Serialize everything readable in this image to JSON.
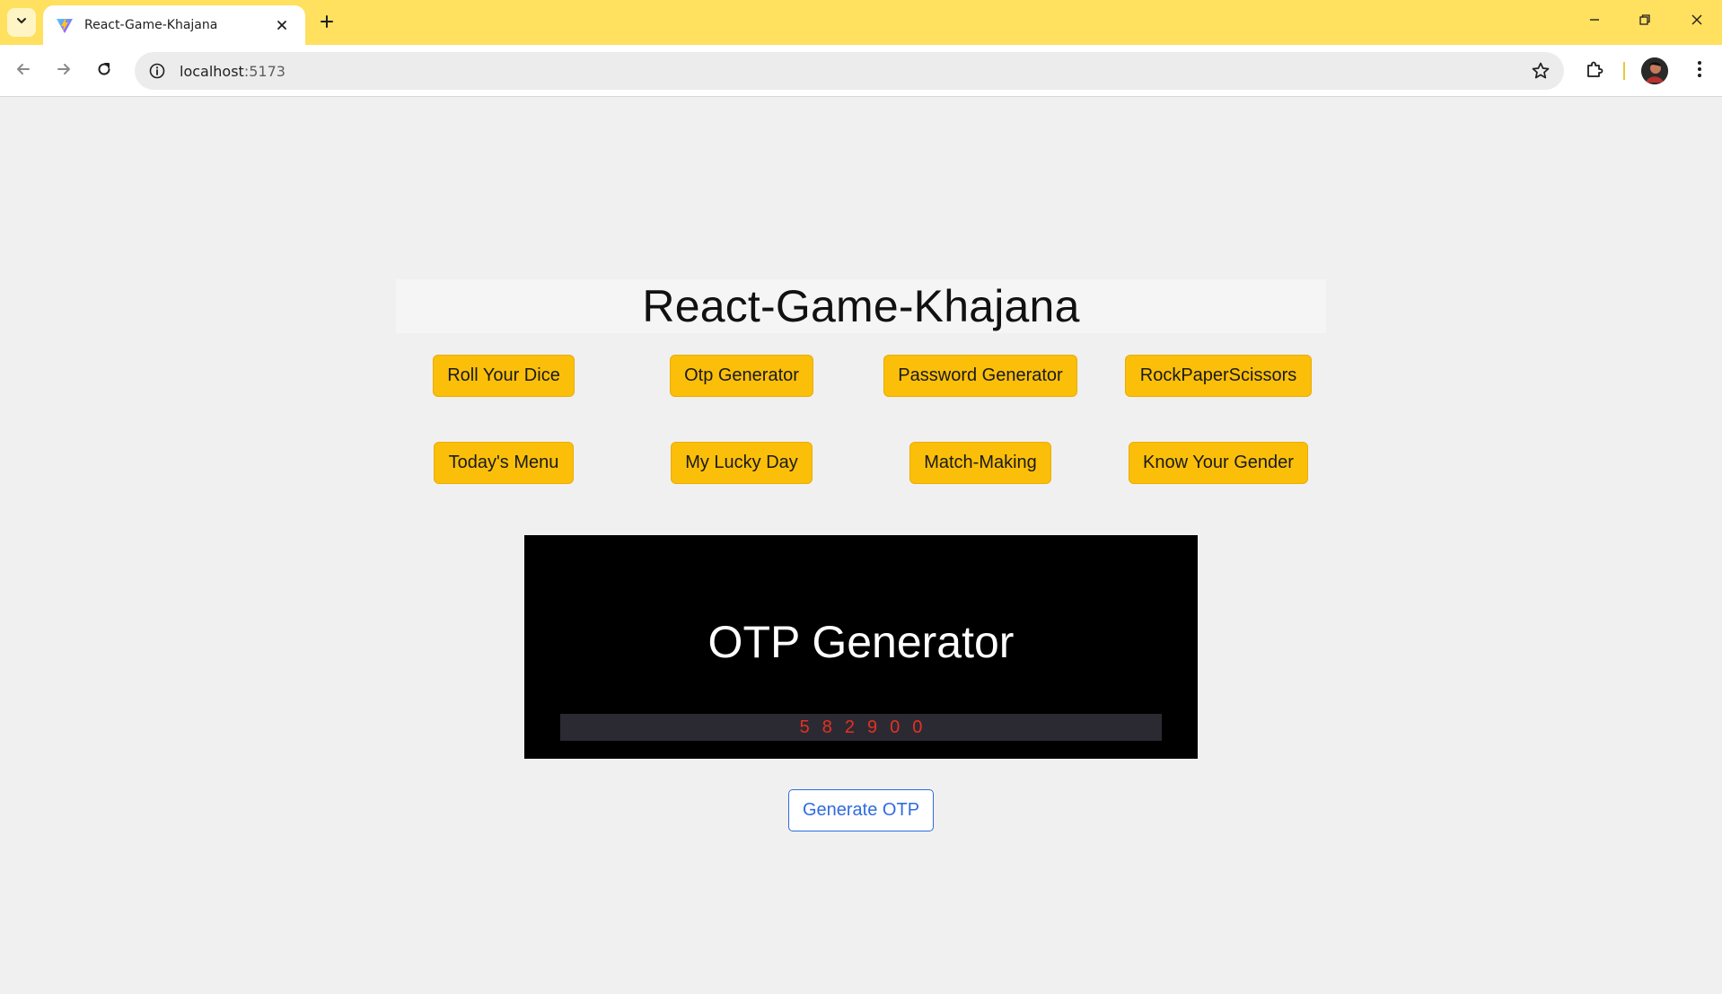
{
  "browser": {
    "tab_title": "React-Game-Khajana",
    "url_host": "localhost",
    "url_port": ":5173",
    "theme_color": "#ffe05f"
  },
  "page": {
    "title": "React-Game-Khajana",
    "games_row1": [
      "Roll Your Dice",
      "Otp Generator",
      "Password Generator",
      "RockPaperScissors"
    ],
    "games_row2": [
      "Today's Menu",
      "My Lucky Day",
      "Match-Making",
      "Know Your Gender"
    ],
    "button_color": "#fbbf0a",
    "otp_panel": {
      "heading": "OTP Generator",
      "otp_value": "582900",
      "otp_color": "#e53023"
    },
    "generate_button": "Generate OTP"
  }
}
